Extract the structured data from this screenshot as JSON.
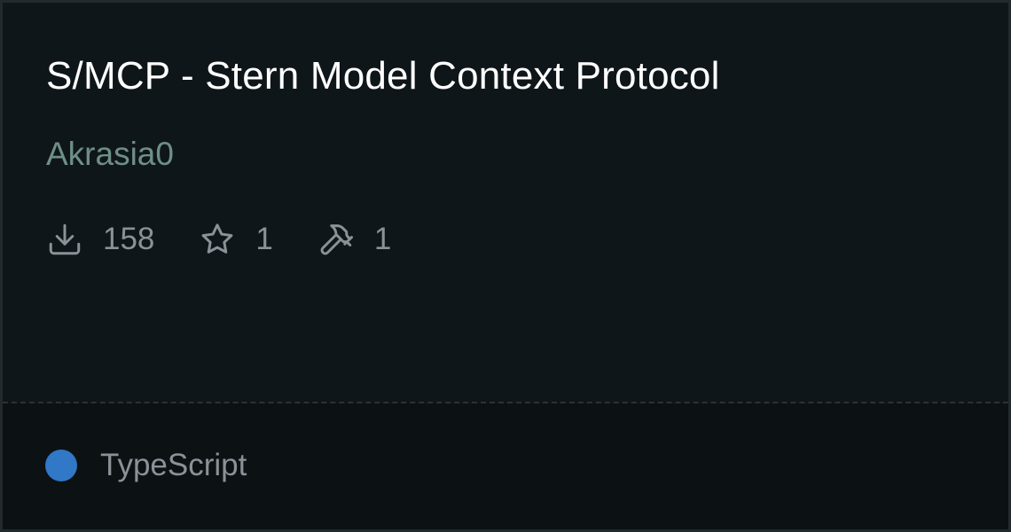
{
  "card": {
    "title": "S/MCP - Stern Model Context Protocol",
    "author": "Akrasia0",
    "author_color": "#6f8f88",
    "stats": {
      "downloads": "158",
      "stars": "1",
      "tools": "1"
    },
    "icons": {
      "downloads": "download-icon",
      "stars": "star-icon",
      "tools": "hammer-icon"
    },
    "language": {
      "name": "TypeScript",
      "color": "#3178c6"
    }
  }
}
